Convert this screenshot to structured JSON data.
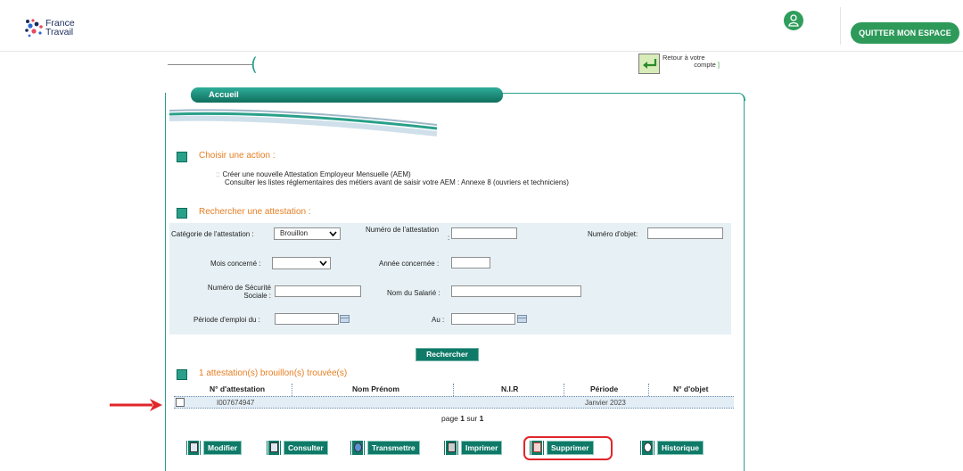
{
  "header": {
    "logo_line1": "France",
    "logo_line2": "Travail",
    "quit_label": "QUITTER MON ESPACE"
  },
  "return_link": {
    "line1": "Retour à votre",
    "line2": "compte",
    "bracket": "]"
  },
  "paren": "(",
  "tab_title": "Accueil",
  "actions": {
    "title": "Choisir une action :",
    "line1": "Créer une nouvelle Attestation Employeur Mensuelle (AEM)",
    "line2": "Consulter les listes réglementaires des métiers avant de saisir votre AEM :  Annexe 8 (ouvriers et techniciens)"
  },
  "search": {
    "title": "Rechercher une attestation :",
    "categorie_label": "Catégorie de l'attestation :",
    "categorie_value": "Brouillon",
    "numero_attestation_label": "Numéro de l'attestation",
    "numero_attestation_colon": ":",
    "numero_objet_label": "Numéro d'objet:",
    "mois_label": "Mois concerné :",
    "annee_label": "Année concernée :",
    "secu_label_1": "Numéro de Sécurité",
    "secu_label_2": "Sociale :",
    "nom_label": "Nom du Salarié :",
    "periode_label": "Période d'emploi du :",
    "au_label": "Au :",
    "button": "Rechercher"
  },
  "results": {
    "title": "1 attestation(s) brouillon(s) trouvée(s)",
    "columns": [
      "N° d'attestation",
      "Nom Prénom",
      "N.I.R",
      "Période",
      "N° d'objet"
    ],
    "rows": [
      {
        "numero": "I007674947",
        "nom": "",
        "nir": "",
        "periode": "Janvier 2023",
        "objet": ""
      }
    ],
    "pager_prefix": "page",
    "pager_page": "1",
    "pager_mid": "sur",
    "pager_total": "1"
  },
  "buttons": {
    "modifier": "Modifier",
    "consulter": "Consulter",
    "transmettre": "Transmettre",
    "imprimer": "Imprimer",
    "supprimer": "Supprimer",
    "historique": "Historique"
  },
  "colors": {
    "teal": "#2aa08a",
    "teal_dark": "#0f7a68",
    "orange": "#e67e22",
    "green_btn": "#2e9a5a",
    "highlight_red": "#e0262b"
  }
}
